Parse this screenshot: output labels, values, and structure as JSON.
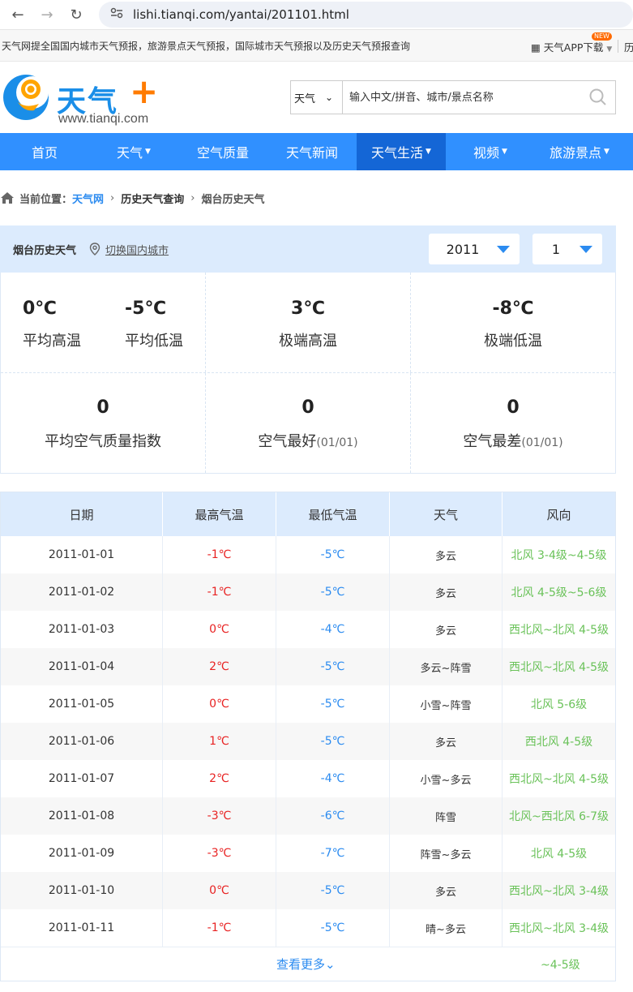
{
  "browser": {
    "url": "lishi.tianqi.com/yantai/201101.html"
  },
  "topstrip": {
    "intro": "天气网提全国国内城市天气预报，旅游景点天气预报，国际城市天气预报以及历史天气预报查询",
    "app": "天气APP下载",
    "new_badge": "NEW",
    "cut_text": "历"
  },
  "header": {
    "brand": "天气",
    "site_url": "www.tianqi.com",
    "search_select": "天气",
    "search_placeholder": "输入中文/拼音、城市/景点名称"
  },
  "nav": [
    {
      "label": "首页",
      "dropdown": false,
      "active": false
    },
    {
      "label": "天气",
      "dropdown": true,
      "active": false
    },
    {
      "label": "空气质量",
      "dropdown": false,
      "active": false
    },
    {
      "label": "天气新闻",
      "dropdown": false,
      "active": false
    },
    {
      "label": "天气生活",
      "dropdown": true,
      "active": true
    },
    {
      "label": "视频",
      "dropdown": true,
      "active": false
    },
    {
      "label": "旅游景点",
      "dropdown": true,
      "active": false
    }
  ],
  "breadcrumb": {
    "prefix": "当前位置：",
    "home": "天气网",
    "level2": "历史天气查询",
    "current": "烟台历史天气"
  },
  "panel": {
    "city_title": "烟台历史天气",
    "switch_link": "切换国内城市",
    "year": "2011",
    "month": "1"
  },
  "stats": {
    "avg_high": {
      "value": "0℃",
      "label": "平均高温"
    },
    "avg_low": {
      "value": "-5℃",
      "label": "平均低温"
    },
    "extreme_high": {
      "value": "3℃",
      "label": "极端高温"
    },
    "extreme_low": {
      "value": "-8℃",
      "label": "极端低温"
    },
    "avg_aqi": {
      "value": "0",
      "label": "平均空气质量指数"
    },
    "best_air": {
      "value": "0",
      "label": "空气最好",
      "date": "(01/01)"
    },
    "worst_air": {
      "value": "0",
      "label": "空气最差",
      "date": "(01/01)"
    }
  },
  "table": {
    "headers": [
      "日期",
      "最高气温",
      "最低气温",
      "天气",
      "风向"
    ],
    "rows": [
      [
        "2011-01-01",
        "-1℃",
        "-5℃",
        "多云",
        "北风 3-4级~4-5级"
      ],
      [
        "2011-01-02",
        "-1℃",
        "-5℃",
        "多云",
        "北风 4-5级~5-6级"
      ],
      [
        "2011-01-03",
        "0℃",
        "-4℃",
        "多云",
        "西北风~北风 4-5级"
      ],
      [
        "2011-01-04",
        "2℃",
        "-5℃",
        "多云~阵雪",
        "西北风~北风 4-5级"
      ],
      [
        "2011-01-05",
        "0℃",
        "-5℃",
        "小雪~阵雪",
        "北风 5-6级"
      ],
      [
        "2011-01-06",
        "1℃",
        "-5℃",
        "多云",
        "西北风 4-5级"
      ],
      [
        "2011-01-07",
        "2℃",
        "-4℃",
        "小雪~多云",
        "西北风~北风 4-5级"
      ],
      [
        "2011-01-08",
        "-3℃",
        "-6℃",
        "阵雪",
        "北风~西北风 6-7级"
      ],
      [
        "2011-01-09",
        "-3℃",
        "-7℃",
        "阵雪~多云",
        "北风 4-5级"
      ],
      [
        "2011-01-10",
        "0℃",
        "-5℃",
        "多云",
        "西北风~北风 3-4级"
      ],
      [
        "2011-01-11",
        "-1℃",
        "-5℃",
        "晴~多云",
        "西北风~北风 3-4级"
      ]
    ],
    "more_label": "查看更多",
    "overflow_text": "~4-5级"
  }
}
